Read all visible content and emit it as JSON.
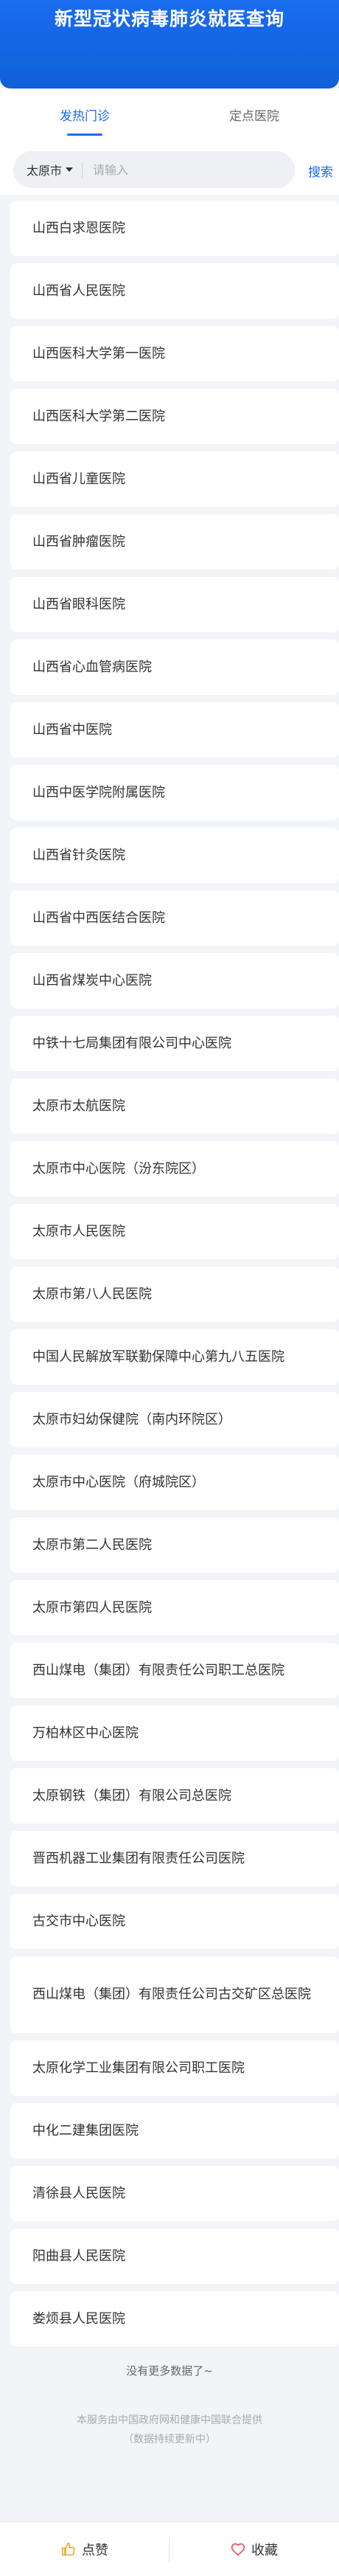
{
  "header": {
    "title": "新型冠状病毒肺炎就医查询"
  },
  "tabs": [
    {
      "label": "发热门诊",
      "active": true
    },
    {
      "label": "定点医院",
      "active": false
    }
  ],
  "search": {
    "city": "太原市",
    "placeholder": "请输入",
    "button_label": "搜索"
  },
  "hospitals": [
    "山西白求恩医院",
    "山西省人民医院",
    "山西医科大学第一医院",
    "山西医科大学第二医院",
    "山西省儿童医院",
    "山西省肿瘤医院",
    "山西省眼科医院",
    "山西省心血管病医院",
    "山西省中医院",
    "山西中医学院附属医院",
    "山西省针灸医院",
    "山西省中西医结合医院",
    "山西省煤炭中心医院",
    "中铁十七局集团有限公司中心医院",
    "太原市太航医院",
    "太原市中心医院（汾东院区）",
    "太原市人民医院",
    "太原市第八人民医院",
    "中国人民解放军联勤保障中心第九八五医院",
    "太原市妇幼保健院（南内环院区）",
    "太原市中心医院（府城院区）",
    "太原市第二人民医院",
    "太原市第四人民医院",
    "西山煤电（集团）有限责任公司职工总医院",
    "万柏林区中心医院",
    "太原钢铁（集团）有限公司总医院",
    "晋西机器工业集团有限责任公司医院",
    "古交市中心医院",
    "西山煤电（集团）有限责任公司古交矿区总医院",
    "太原化学工业集团有限公司职工医院",
    "中化二建集团医院",
    "清徐县人民医院",
    "阳曲县人民医院",
    "娄烦县人民医院"
  ],
  "list_end": "没有更多数据了~",
  "footer": {
    "line1": "本服务由中国政府网和健康中国联合提供",
    "line2": "（数据持续更新中）"
  },
  "bottom_bar": {
    "like_label": "点赞",
    "favorite_label": "收藏",
    "like_icon": "thumbs-up-icon",
    "favorite_icon": "heart-icon"
  },
  "colors": {
    "brand": "#1a6cf0",
    "like_icon": "#f0a020",
    "favorite_icon": "#e8424c"
  }
}
